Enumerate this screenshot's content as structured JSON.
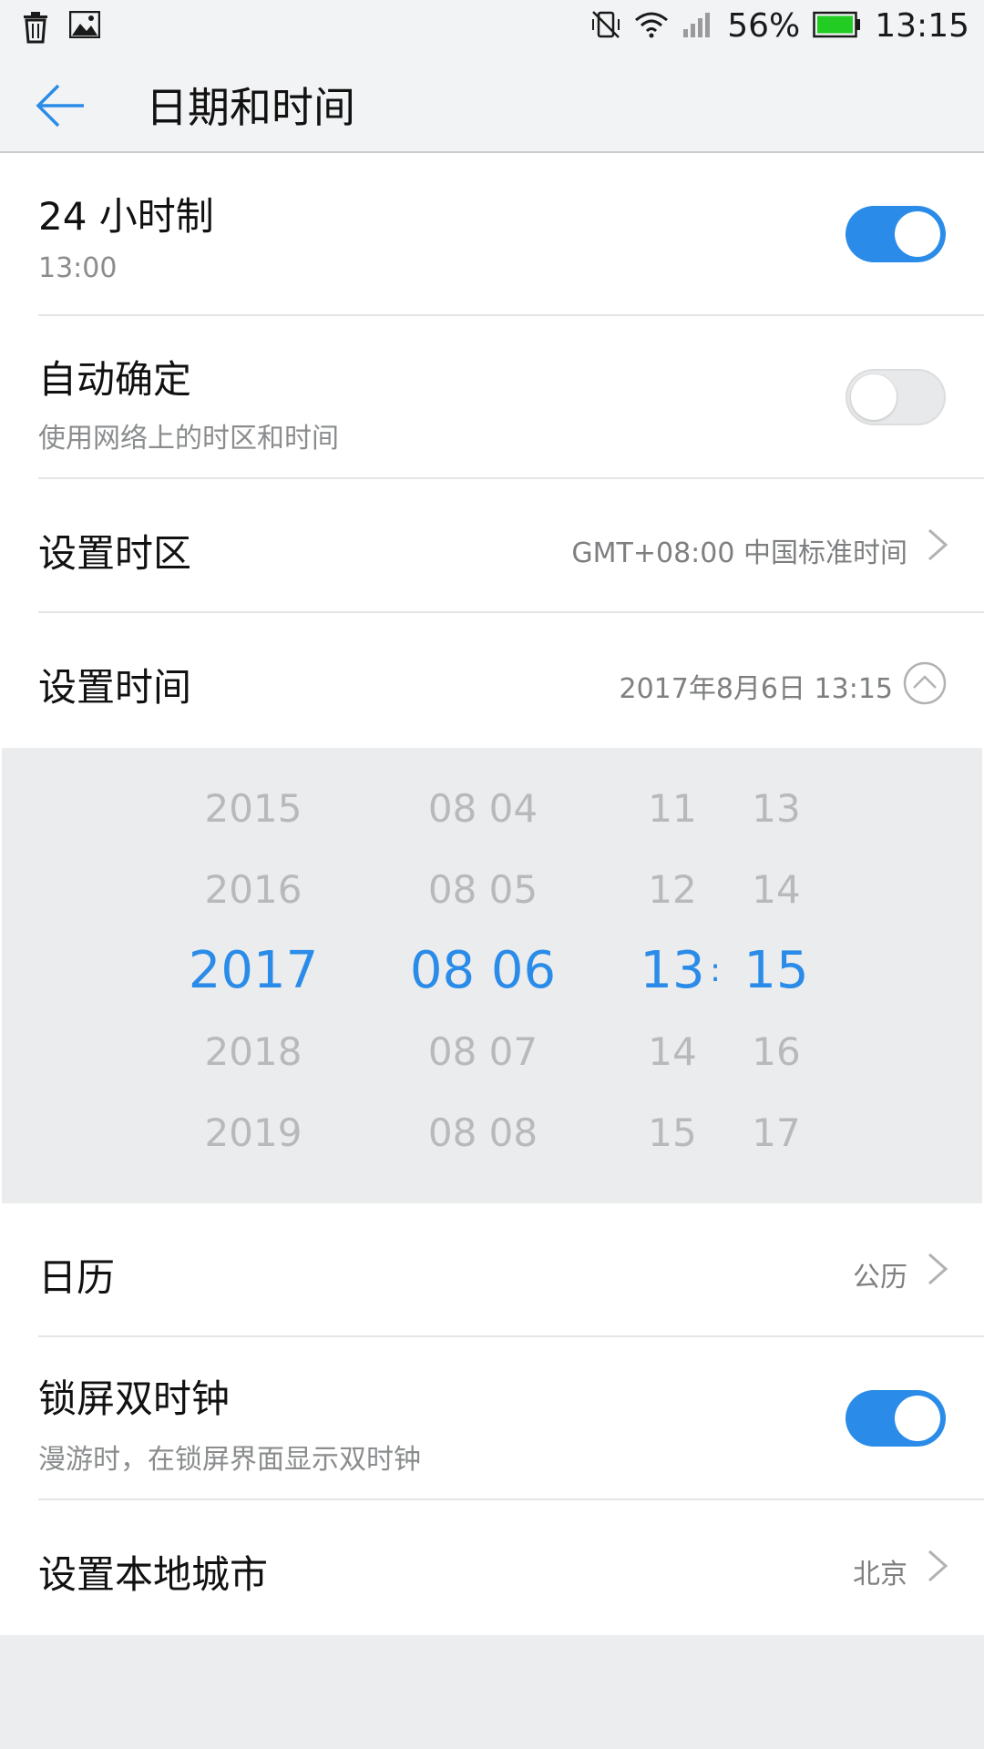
{
  "status_bar": {
    "battery_percent": "56%",
    "time": "13:15",
    "icons": [
      "trash-icon",
      "image-icon",
      "vibrate-off-icon",
      "wifi-icon",
      "signal-icon",
      "battery-icon"
    ]
  },
  "header": {
    "title": "日期和时间",
    "back_icon": "back-arrow-icon"
  },
  "settings": {
    "hour24": {
      "title": "24 小时制",
      "subtitle": "13:00",
      "enabled": true
    },
    "auto": {
      "title": "自动确定",
      "subtitle": "使用网络上的时区和时间",
      "enabled": false
    },
    "timezone": {
      "title": "设置时区",
      "value": "GMT+08:00 中国标准时间"
    },
    "set_time": {
      "title": "设置时间",
      "value": "2017年8月6日 13:15"
    },
    "calendar": {
      "title": "日历",
      "value": "公历"
    },
    "dual_clock": {
      "title": "锁屏双时钟",
      "subtitle": "漫游时，在锁屏界面显示双时钟",
      "enabled": true
    },
    "local_city": {
      "title": "设置本地城市",
      "value": "北京"
    }
  },
  "picker": {
    "years": [
      "2015",
      "2016",
      "2017",
      "2018",
      "2019"
    ],
    "dates": [
      "08 04",
      "08 05",
      "08 06",
      "08 07",
      "08 08"
    ],
    "hours": [
      "11",
      "12",
      "13",
      "14",
      "15"
    ],
    "minutes": [
      "13",
      "14",
      "15",
      "16",
      "17"
    ],
    "separator": ":",
    "selected_index": 2
  },
  "colors": {
    "accent": "#2a8ce8",
    "muted": "#b8b9bb"
  }
}
